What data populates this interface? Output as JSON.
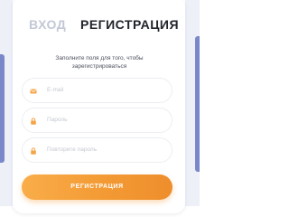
{
  "tabs": {
    "login": "ВХОД",
    "register": "РЕГИСТРАЦИЯ"
  },
  "hint": "Заполните поля для того, чтобы зарегистрироваться",
  "form": {
    "fields": [
      {
        "placeholder": "E-mail",
        "icon": "email-icon"
      },
      {
        "placeholder": "Пароль",
        "icon": "lock-icon"
      },
      {
        "placeholder": "Повторите пароль",
        "icon": "lock-icon"
      }
    ],
    "submit_label": "РЕГИСТРАЦИЯ"
  },
  "colors": {
    "accent_orange": "#f39a34",
    "active_tab": "#22242c",
    "inactive_tab": "#c3c8d6",
    "side_accent": "#7a88c9"
  }
}
